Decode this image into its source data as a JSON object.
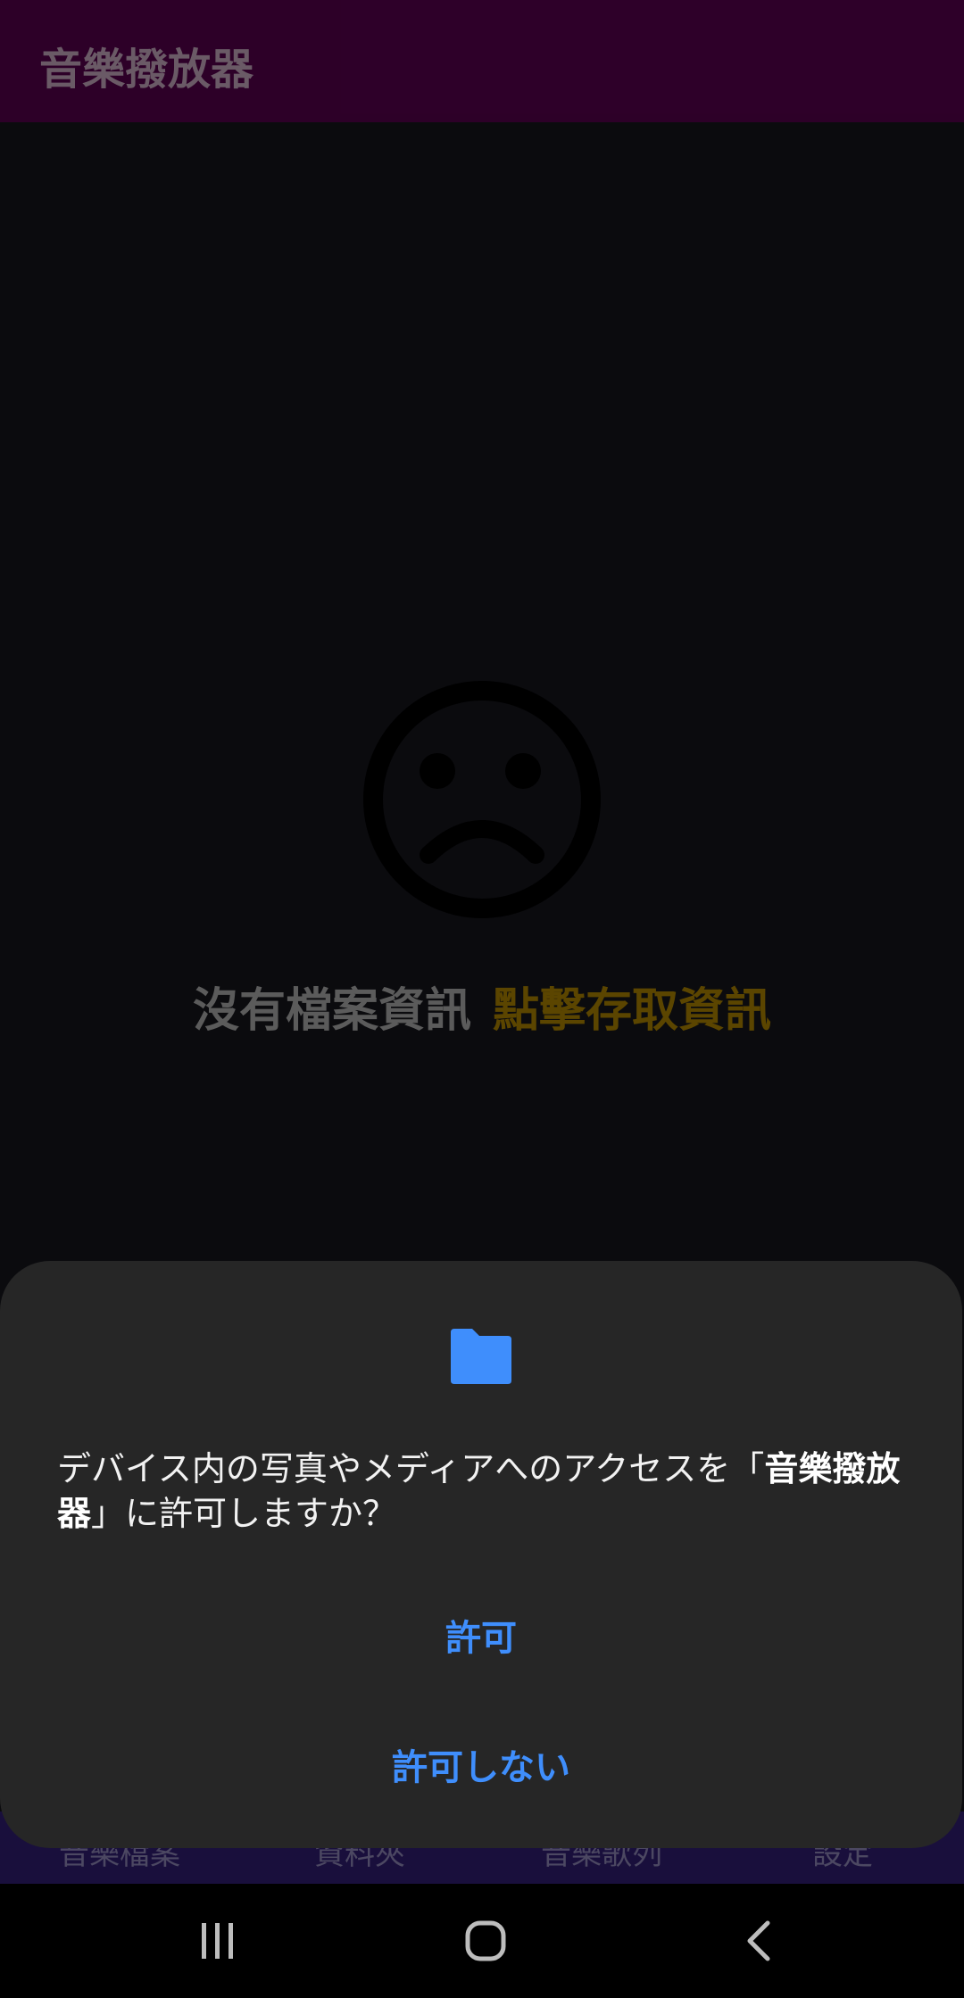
{
  "app": {
    "title": "音樂撥放器"
  },
  "empty_state": {
    "icon": "sad-face-icon",
    "message": "沒有檔案資訊",
    "action": "點擊存取資訊"
  },
  "bottom_nav": {
    "items": [
      {
        "label": "音樂檔案"
      },
      {
        "label": "資料夾"
      },
      {
        "label": "音樂歌列"
      },
      {
        "label": "設定"
      }
    ]
  },
  "permission_dialog": {
    "icon": "folder-icon",
    "message_prefix": "デバイス内の写真やメディアへのアクセスを「",
    "app_name": "音樂撥放器",
    "message_suffix": "」に許可しますか？",
    "allow_label": "許可",
    "deny_label": "許可しない",
    "accent_color": "#3f8efc"
  },
  "system_nav": {
    "recents": "recents-icon",
    "home": "home-icon",
    "back": "back-icon"
  }
}
